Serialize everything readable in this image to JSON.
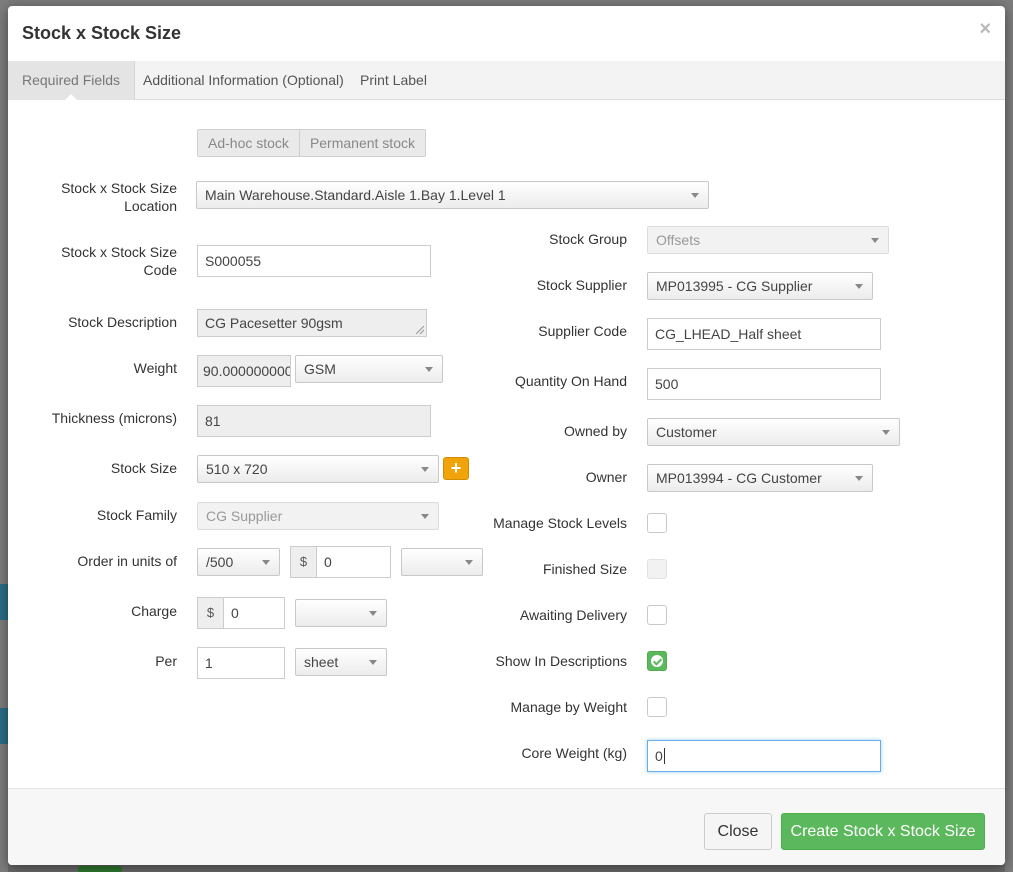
{
  "dialog": {
    "title": "Stock x Stock Size",
    "close_glyph": "×",
    "tabs": [
      {
        "label": "Required Fields",
        "active": true
      },
      {
        "label": "Additional Information (Optional)",
        "active": false
      },
      {
        "label": "Print Label",
        "active": false
      }
    ]
  },
  "stock_type": {
    "options": [
      "Ad-hoc stock",
      "Permanent stock"
    ]
  },
  "left": {
    "location": {
      "label_line1": "Stock x Stock Size",
      "label_line2": "Location",
      "value": "Main Warehouse.Standard.Aisle 1.Bay 1.Level 1"
    },
    "code": {
      "label_line1": "Stock x Stock Size",
      "label_line2": "Code",
      "value": "S000055"
    },
    "description": {
      "label": "Stock Description",
      "value": "CG Pacesetter 90gsm"
    },
    "weight": {
      "label": "Weight",
      "value": "90.0000000000",
      "unit": "GSM"
    },
    "thickness": {
      "label": "Thickness (microns)",
      "value": "81"
    },
    "stock_size": {
      "label": "Stock Size",
      "value": "510 x 720",
      "add_glyph": "+"
    },
    "stock_family": {
      "label": "Stock Family",
      "value": "CG Supplier"
    },
    "order_units": {
      "label": "Order in units of",
      "unit": "/500",
      "currency": "$",
      "price": "0",
      "extra": ""
    },
    "charge": {
      "label": "Charge",
      "currency": "$",
      "value": "0",
      "extra": ""
    },
    "per": {
      "label": "Per",
      "value": "1",
      "unit": "sheet"
    }
  },
  "right": {
    "stock_group": {
      "label": "Stock Group",
      "value": "Offsets"
    },
    "stock_supplier": {
      "label": "Stock Supplier",
      "value": "MP013995 - CG Supplier"
    },
    "supplier_code": {
      "label": "Supplier Code",
      "value": "CG_LHEAD_Half sheet"
    },
    "quantity": {
      "label": "Quantity On Hand",
      "value": "500"
    },
    "owned_by": {
      "label": "Owned by",
      "value": "Customer"
    },
    "owner": {
      "label": "Owner",
      "value": "MP013994 - CG Customer"
    },
    "manage_levels": {
      "label": "Manage Stock Levels",
      "checked": false
    },
    "finished_size": {
      "label": "Finished Size",
      "checked": false,
      "disabled": true
    },
    "awaiting_delivery": {
      "label": "Awaiting Delivery",
      "checked": false
    },
    "show_in_descriptions": {
      "label": "Show In Descriptions",
      "checked": true
    },
    "manage_by_weight": {
      "label": "Manage by Weight",
      "checked": false
    },
    "core_weight": {
      "label": "Core Weight (kg)",
      "value": "0"
    }
  },
  "footer": {
    "close_label": "Close",
    "create_label": "Create Stock x Stock Size"
  },
  "colors": {
    "primary_green": "#5cb85c",
    "accent_orange": "#f0a30a",
    "focus_blue": "#66afe9"
  }
}
